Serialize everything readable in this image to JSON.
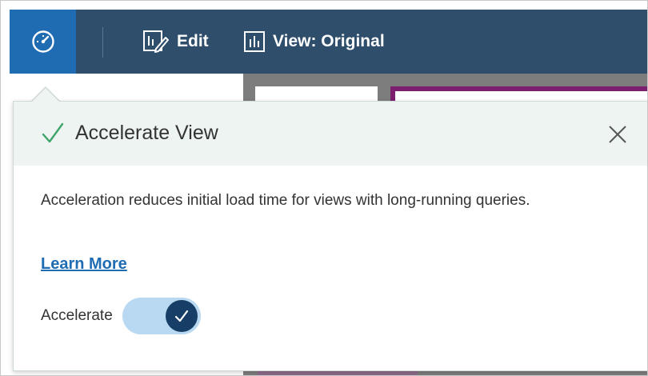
{
  "toolbar": {
    "gauge_icon": "gauge-icon",
    "edit_icon": "edit-pencil-icon",
    "edit_label": "Edit",
    "view_icon": "bar-chart-icon",
    "view_label": "View: Original"
  },
  "popup": {
    "title": "Accelerate View",
    "title_icon": "check-icon",
    "close_icon": "close-icon",
    "description": "Acceleration reduces initial load time for views with long-running queries.",
    "learn_more": "Learn More",
    "toggle_label": "Accelerate",
    "toggle_on": true
  },
  "colors": {
    "toolbar_bg": "#2e4e6b",
    "gauge_button_bg": "#1f6cb3",
    "popup_header_bg": "#edf4f1",
    "check_green": "#3fa56b",
    "link_blue": "#1f6cb3",
    "toggle_track": "#b9d9f2",
    "toggle_knob": "#163e66"
  }
}
